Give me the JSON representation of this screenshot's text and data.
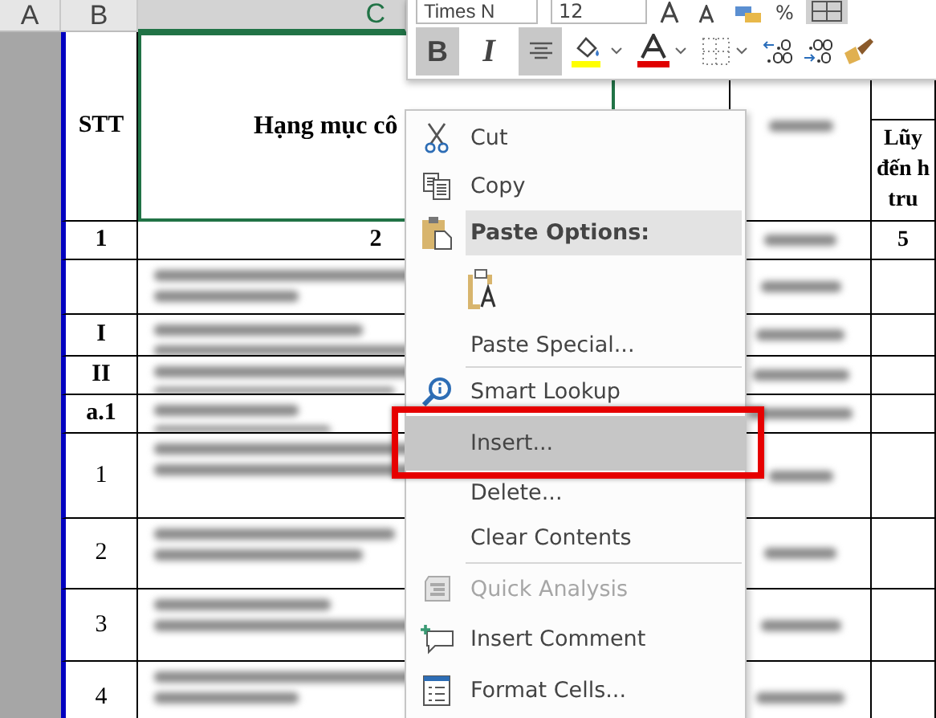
{
  "columns": [
    {
      "label": "A",
      "selected": false
    },
    {
      "label": "B",
      "selected": false
    },
    {
      "label": "C",
      "selected": true
    }
  ],
  "rows": [
    {
      "kind": "title",
      "b": "STT",
      "c": "Hạng mục cô",
      "f_lines": [
        "Lũy",
        "đến h",
        "tru"
      ]
    },
    {
      "kind": "numbering",
      "b": "1",
      "c": "2",
      "f": "5"
    },
    {
      "kind": "section"
    },
    {
      "kind": "section",
      "b": "I"
    },
    {
      "kind": "section",
      "b": "II"
    },
    {
      "kind": "section",
      "b": "a.1"
    },
    {
      "kind": "item",
      "b": "1"
    },
    {
      "kind": "item",
      "b": "2"
    },
    {
      "kind": "item",
      "b": "3"
    },
    {
      "kind": "item",
      "b": "4"
    }
  ],
  "mini_toolbar": {
    "font": "Times N",
    "size": "12",
    "percent": "%",
    "buttons": [
      {
        "kind": "bold",
        "label": "B",
        "pressed": true
      },
      {
        "kind": "italic",
        "label": "I",
        "pressed": false
      },
      {
        "kind": "center",
        "pressed": true
      }
    ]
  },
  "context_menu": [
    {
      "kind": "command",
      "label": "Cut",
      "disabled": false,
      "selected": false,
      "callout": false,
      "separator_before": false
    },
    {
      "kind": "command",
      "label": "Copy",
      "disabled": false,
      "selected": false,
      "callout": false,
      "separator_before": false
    },
    {
      "kind": "heading",
      "label": "Paste Options:"
    },
    {
      "kind": "paste-buttons"
    },
    {
      "kind": "command",
      "label": "Paste Special...",
      "disabled": false,
      "selected": false,
      "callout": false,
      "separator_before": false
    },
    {
      "kind": "command",
      "label": "Smart Lookup",
      "disabled": false,
      "selected": false,
      "callout": false,
      "separator_before": true
    },
    {
      "kind": "command",
      "label": "Insert...",
      "disabled": false,
      "selected": true,
      "callout": true,
      "separator_before": false
    },
    {
      "kind": "command",
      "label": "Delete...",
      "disabled": false,
      "selected": false,
      "callout": false,
      "separator_before": false
    },
    {
      "kind": "command",
      "label": "Clear Contents",
      "disabled": false,
      "selected": false,
      "callout": false,
      "separator_before": false
    },
    {
      "kind": "command",
      "label": "Quick Analysis",
      "disabled": true,
      "selected": false,
      "callout": false,
      "separator_before": true
    },
    {
      "kind": "command",
      "label": "Insert Comment",
      "disabled": false,
      "selected": false,
      "callout": false,
      "separator_before": false
    },
    {
      "kind": "command",
      "label": "Format Cells...",
      "disabled": false,
      "selected": false,
      "callout": false,
      "separator_before": false
    }
  ]
}
